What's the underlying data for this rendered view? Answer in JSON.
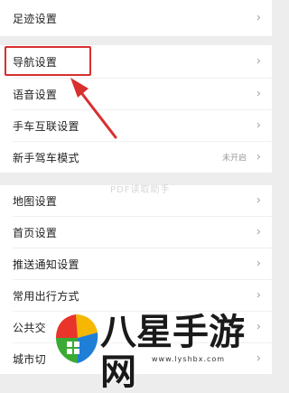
{
  "menu_groups": [
    {
      "items": [
        {
          "label": "足迹设置"
        }
      ]
    },
    {
      "items": [
        {
          "label": "导航设置"
        },
        {
          "label": "语音设置"
        },
        {
          "label": "手车互联设置"
        },
        {
          "label": "新手驾车模式",
          "status": "未开启"
        }
      ]
    },
    {
      "items": [
        {
          "label": "地图设置"
        },
        {
          "label": "首页设置"
        },
        {
          "label": "推送通知设置"
        },
        {
          "label": "常用出行方式"
        },
        {
          "label": "公共交"
        },
        {
          "label": "城市切"
        }
      ]
    }
  ],
  "chevron": "›",
  "watermark_mid": "PDF读取助手",
  "logo": {
    "text": "八星手游网",
    "url": "www.lyshbx.com",
    "colors": [
      "#f5b700",
      "#e8342a",
      "#3aaa35",
      "#1f7fd6"
    ]
  }
}
